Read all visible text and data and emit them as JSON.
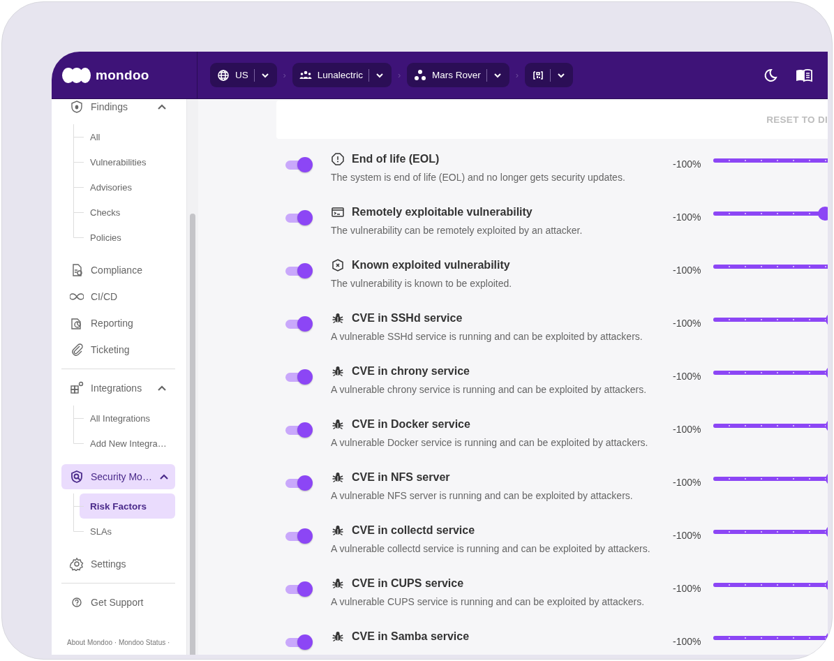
{
  "header": {
    "logo": "mondoo",
    "breadcrumbs": [
      {
        "kind": "region",
        "label": "US"
      },
      {
        "kind": "organization",
        "label": "Lunalectric",
        "separator": "›"
      },
      {
        "kind": "space",
        "label": "Mars Rover",
        "separator": "›"
      },
      {
        "kind": "asset",
        "separator": "›"
      }
    ]
  },
  "sidebar": {
    "items": [
      {
        "kind": "findings",
        "label": "Findings",
        "expanded": true,
        "selected": false,
        "children": [
          {
            "label": "All",
            "selected": false
          },
          {
            "label": "Vulnerabilities",
            "selected": false
          },
          {
            "label": "Advisories",
            "selected": false
          },
          {
            "label": "Checks",
            "selected": false
          },
          {
            "label": "Policies",
            "selected": false
          }
        ]
      },
      {
        "kind": "compliance",
        "label": "Compliance",
        "selected": false
      },
      {
        "kind": "cicd",
        "label": "CI/CD",
        "selected": false
      },
      {
        "kind": "reporting",
        "label": "Reporting",
        "selected": false
      },
      {
        "kind": "ticketing",
        "label": "Ticketing",
        "selected": false,
        "divider_after": true
      },
      {
        "kind": "integrations",
        "label": "Integrations",
        "expanded": true,
        "selected": false,
        "children": [
          {
            "label": "All Integrations",
            "selected": false
          },
          {
            "label": "Add New Integra…",
            "selected": false
          }
        ]
      },
      {
        "kind": "security",
        "label": "Security Mo…",
        "expanded": true,
        "selected": true,
        "children": [
          {
            "label": "Risk Factors",
            "selected": true
          },
          {
            "label": "SLAs",
            "selected": false
          }
        ]
      },
      {
        "kind": "settings",
        "label": "Settings",
        "selected": false,
        "divider_after": true
      },
      {
        "kind": "support",
        "label": "Get Support",
        "selected": false
      }
    ],
    "footer": "About Mondoo · Mondoo Status ·"
  },
  "reset_button": "RESET TO DI",
  "risk_factors": [
    {
      "kind": "eol",
      "title": "End of life (EOL)",
      "description": "The system is end of life (EOL) and no longer gets security updates.",
      "on": true,
      "reading": "-100%",
      "level": 1
    },
    {
      "kind": "remote",
      "title": "Remotely exploitable vulnerability",
      "description": "The vulnerability can be remotely exploited by an attacker.",
      "on": true,
      "reading": "-100%",
      "level": 0.84
    },
    {
      "kind": "exploited",
      "title": "Known exploited vulnerability",
      "description": "The vulnerability is known to be exploited.",
      "on": true,
      "reading": "-100%",
      "level": 1
    },
    {
      "kind": "cve",
      "title": "CVE in SSHd service",
      "description": "A vulnerable SSHd service is running and can be exploited by attackers.",
      "on": true,
      "reading": "-100%",
      "level": 0.9
    },
    {
      "kind": "cve",
      "title": "CVE in chrony service",
      "description": "A vulnerable chrony service is running and can be exploited by attackers.",
      "on": true,
      "reading": "-100%",
      "level": 0.9
    },
    {
      "kind": "cve",
      "title": "CVE in Docker service",
      "description": "A vulnerable Docker service is running and can be exploited by attackers.",
      "on": true,
      "reading": "-100%",
      "level": 0.9
    },
    {
      "kind": "cve",
      "title": "CVE in NFS server",
      "description": "A vulnerable NFS server is running and can be exploited by attackers.",
      "on": true,
      "reading": "-100%",
      "level": 0.9
    },
    {
      "kind": "cve",
      "title": "CVE in collectd service",
      "description": "A vulnerable collectd service is running and can be exploited by attackers.",
      "on": true,
      "reading": "-100%",
      "level": 0.9
    },
    {
      "kind": "cve",
      "title": "CVE in CUPS service",
      "description": "A vulnerable CUPS service is running and can be exploited by attackers.",
      "on": true,
      "reading": "-100%",
      "level": 0.9
    },
    {
      "kind": "cve",
      "title": "CVE in Samba service",
      "on": true,
      "reading": "-100%",
      "level": 0.9
    }
  ]
}
